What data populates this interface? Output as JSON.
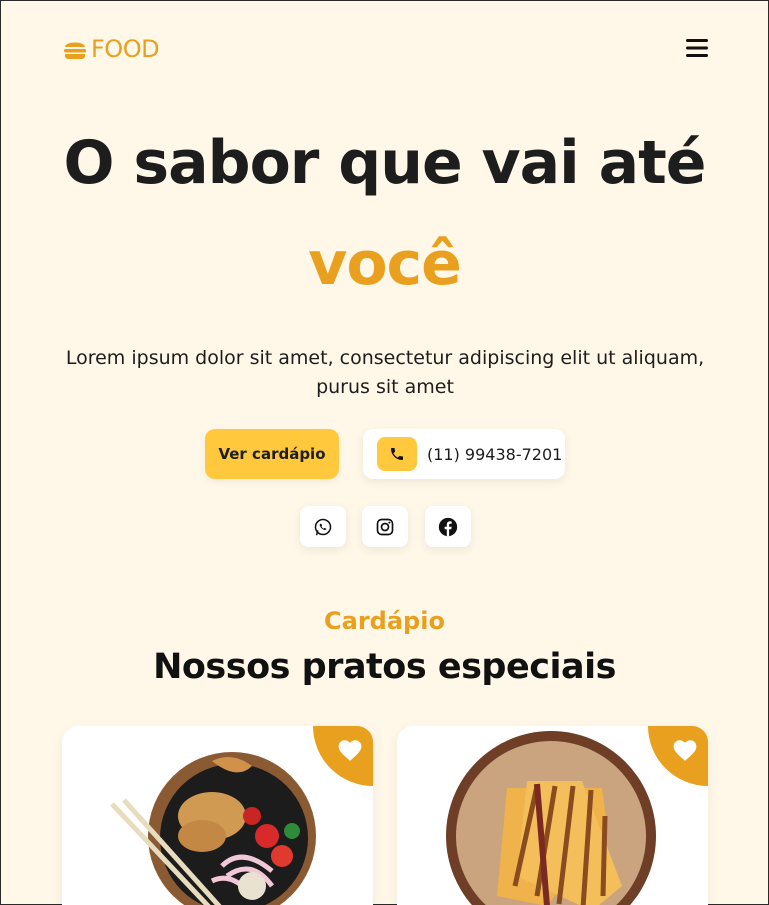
{
  "brand": {
    "name": "FOOD",
    "color": "#E9A01E"
  },
  "header": {
    "menu_icon": "hamburger-menu-icon"
  },
  "hero": {
    "title": "O sabor que vai até",
    "title_accent": "você",
    "description": "Lorem ipsum dolor sit amet, consectetur adipiscing elit ut aliquam, purus sit amet",
    "cta_label": "Ver cardápio",
    "phone": "(11) 99438-7201"
  },
  "social": [
    {
      "icon": "whatsapp-icon"
    },
    {
      "icon": "instagram-icon"
    },
    {
      "icon": "facebook-icon"
    }
  ],
  "menu_section": {
    "kicker": "Cardápio",
    "title": "Nossos pratos especiais"
  },
  "cards": [
    {
      "image": "poke-bowl-dish",
      "fav_icon": "heart-icon"
    },
    {
      "image": "grilled-sandwich-dish",
      "fav_icon": "heart-icon"
    }
  ],
  "colors": {
    "background": "#FFF8E8",
    "accent": "#E9A01E",
    "button": "#FFC83D"
  }
}
